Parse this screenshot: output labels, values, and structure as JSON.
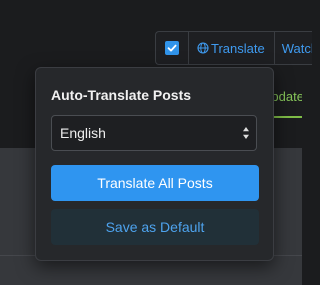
{
  "toolbar": {
    "checkbox_checked": true,
    "translate_label": "Translate",
    "translate_icon": "globe-icon",
    "watch_label": "Watch"
  },
  "background_tab": {
    "label": "Update"
  },
  "popover": {
    "title": "Auto-Translate Posts",
    "language_select": {
      "selected": "English",
      "icon": "select-arrows-icon"
    },
    "translate_all_label": "Translate All Posts",
    "save_default_label": "Save as Default"
  },
  "colors": {
    "accent": "#2f95f0",
    "accent_text": "#3f9bf0",
    "secondary_button_bg": "#213038",
    "tab_green": "#7fbd47",
    "popover_bg": "#26282b",
    "page_bg": "#1b1c1e"
  }
}
